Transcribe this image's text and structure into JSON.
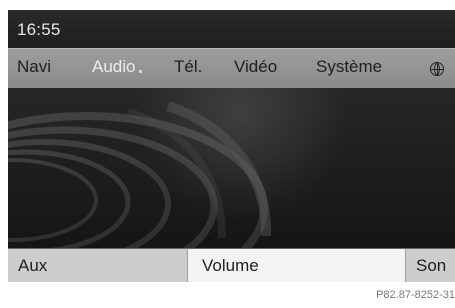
{
  "status": {
    "time": "16:55"
  },
  "menu": {
    "items": [
      {
        "label": "Navi"
      },
      {
        "label": "Audio"
      },
      {
        "label": "Tél."
      },
      {
        "label": "Vidéo"
      },
      {
        "label": "Système"
      }
    ],
    "globe_icon": "globe-icon",
    "active_index": 1
  },
  "function_bar": {
    "left": "Aux",
    "center": "Volume",
    "right": "Son"
  },
  "image_ref": "P82.87-8252-31"
}
